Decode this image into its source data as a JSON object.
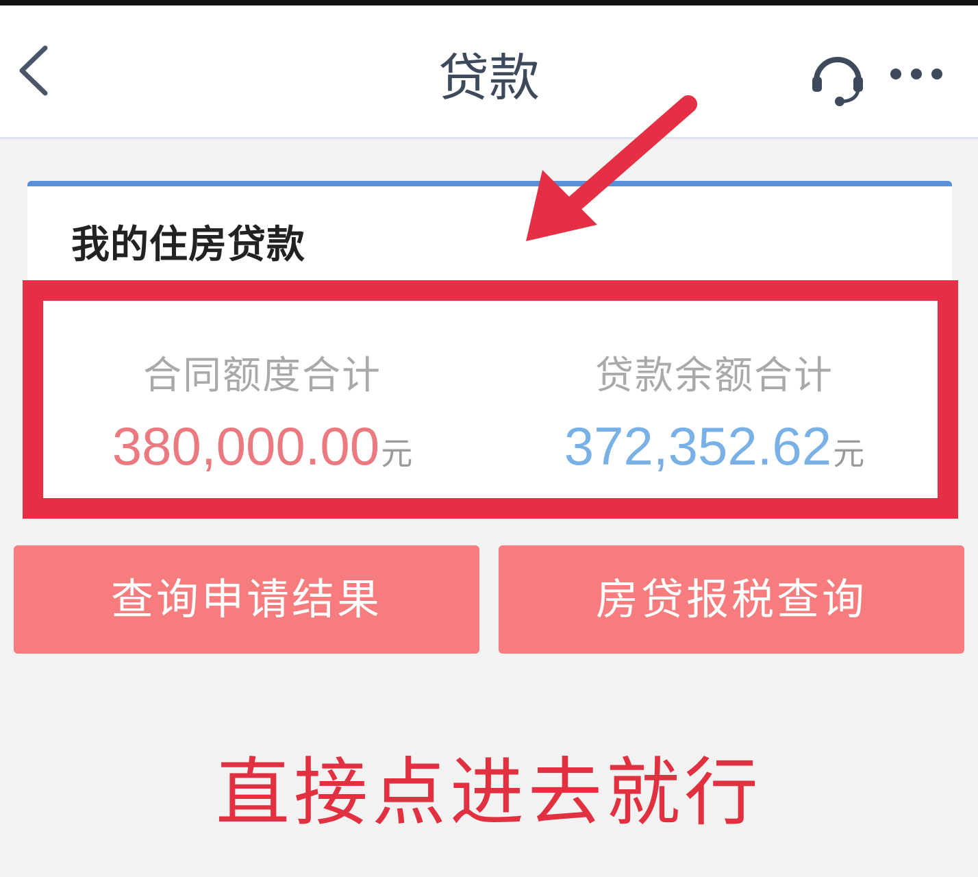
{
  "nav": {
    "title": "贷款",
    "icons": {
      "back": "chevron-left-icon",
      "service": "headset-icon",
      "more": "more-dots-icon"
    }
  },
  "card": {
    "title": "我的住房贷款",
    "contract_total": {
      "label": "合同额度合计",
      "value": "380,000.00",
      "unit": "元"
    },
    "balance_total": {
      "label": "贷款余额合计",
      "value": "372,352.62",
      "unit": "元"
    }
  },
  "actions": {
    "query_result": "查询申请结果",
    "tax_query": "房贷报税查询"
  },
  "caption": "直接点进去就行",
  "colors": {
    "accent_blue": "#5a8fd9",
    "highlight_red": "#e52f45",
    "button_red": "#f77c7d",
    "value_red": "#ea7a80",
    "value_blue": "#79b0e6"
  }
}
